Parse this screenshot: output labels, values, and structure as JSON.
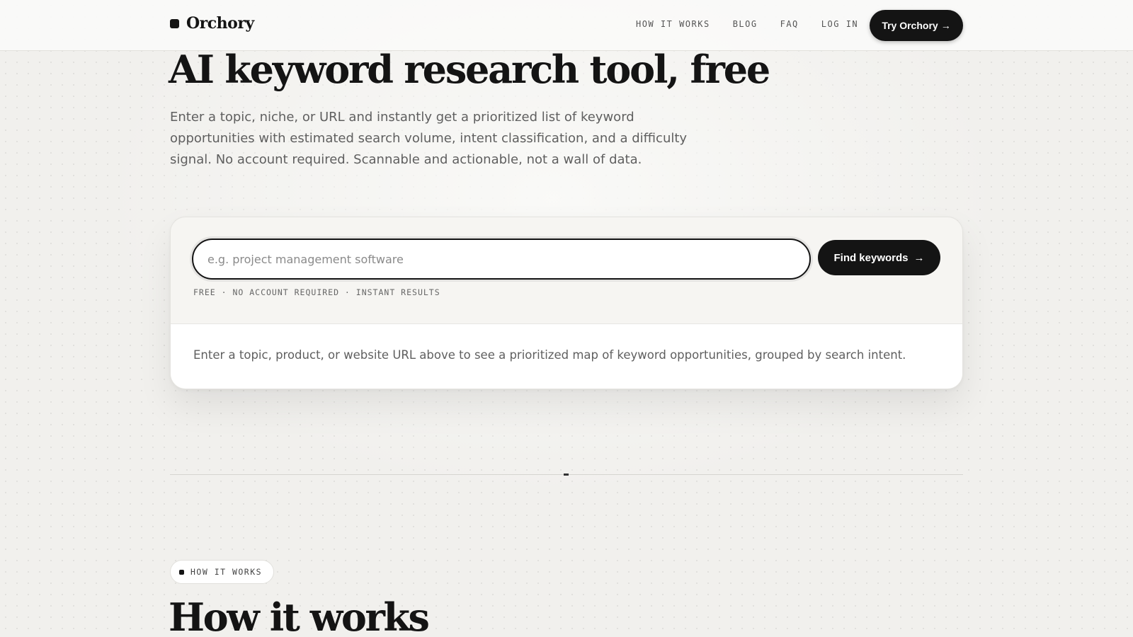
{
  "header": {
    "brand": "Orchory",
    "nav": [
      {
        "label": "HOW IT WORKS"
      },
      {
        "label": "BLOG"
      },
      {
        "label": "FAQ"
      },
      {
        "label": "LOG IN"
      }
    ],
    "cta_label": "Try Orchory",
    "cta_arrow": "→"
  },
  "hero": {
    "title": "AI keyword research tool, free",
    "subtitle": "Enter a topic, niche, or URL and instantly get a prioritized list of keyword opportunities with estimated search volume, intent classification, and a difficulty signal. No account required. Scannable and actionable, not a wall of data."
  },
  "search": {
    "placeholder": "e.g. project management software",
    "value": "",
    "button_label": "Find keywords",
    "button_arrow": "→",
    "note": "FREE · NO ACCOUNT REQUIRED · INSTANT RESULTS",
    "empty_state": "Enter a topic, product, or website URL above to see a prioritized map of keyword opportunities, grouped by search intent."
  },
  "how_it_works": {
    "pill_label": "HOW IT WORKS",
    "title": "How it works"
  },
  "colors": {
    "ink": "#141414",
    "background": "#f1f0ed",
    "muted_text": "#5f5f5f"
  }
}
